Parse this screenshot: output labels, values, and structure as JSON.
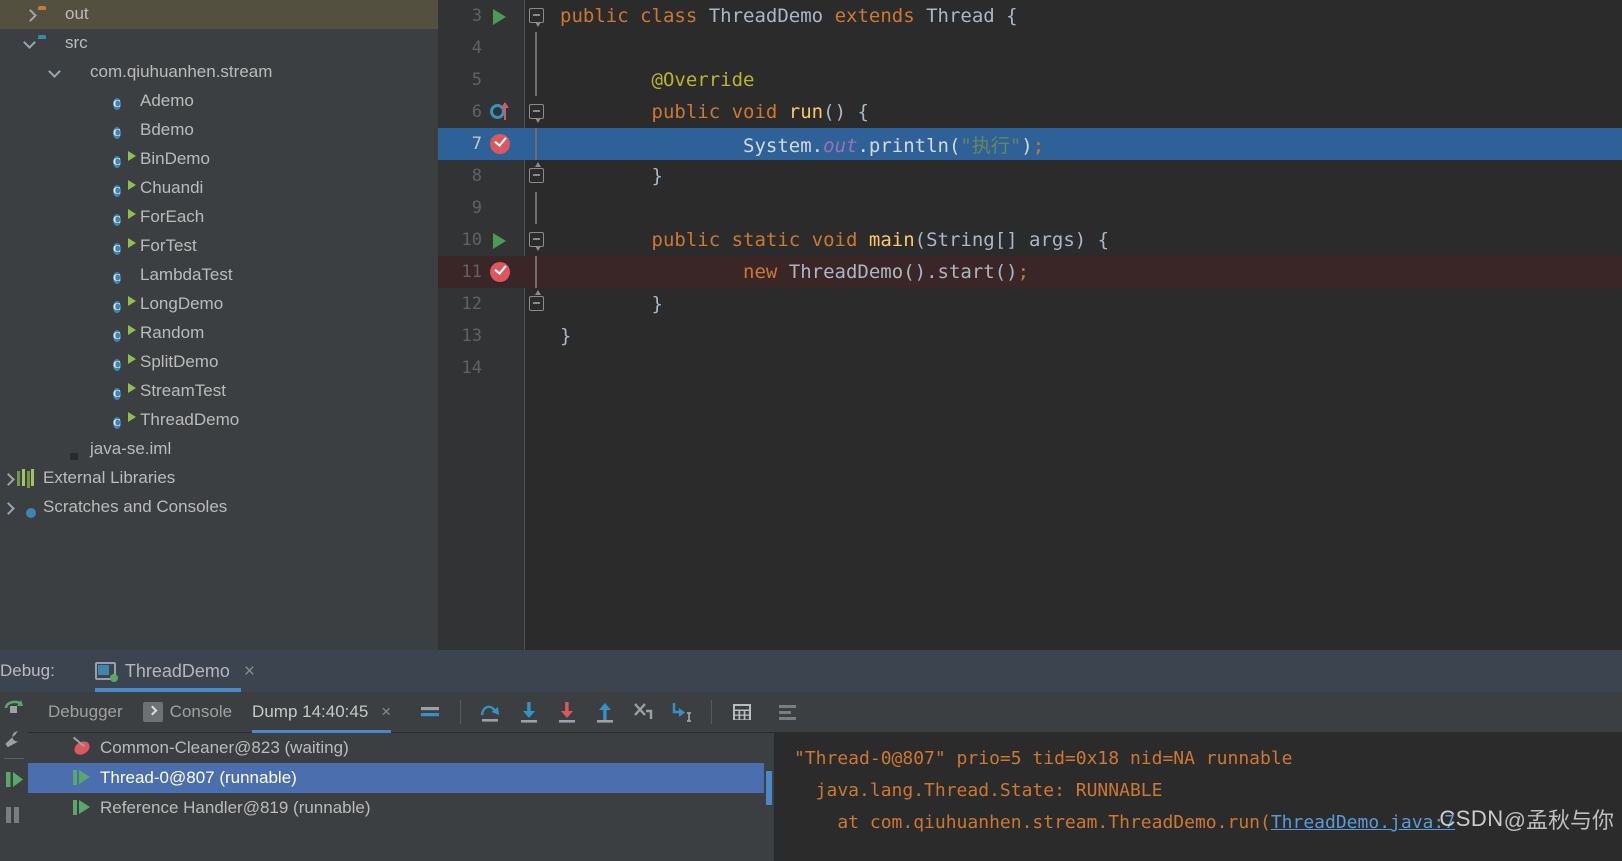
{
  "project_tree": {
    "items": [
      {
        "label": "out",
        "icon": "folder-orange-icon",
        "arrow": "right",
        "indent": 22,
        "selected": true
      },
      {
        "label": "src",
        "icon": "folder-blue-icon",
        "arrow": "down",
        "indent": 22,
        "selected": false
      },
      {
        "label": "com.qiuhuanhen.stream",
        "icon": "package-icon",
        "arrow": "down",
        "indent": 47,
        "selected": false
      },
      {
        "label": "Ademo",
        "icon": "class-icon",
        "arrow": "none",
        "indent": 97,
        "selected": false
      },
      {
        "label": "Bdemo",
        "icon": "class-icon",
        "arrow": "none",
        "indent": 97,
        "selected": false
      },
      {
        "label": "BinDemo",
        "icon": "class-runnable-icon",
        "arrow": "none",
        "indent": 97,
        "selected": false
      },
      {
        "label": "Chuandi",
        "icon": "class-runnable-icon",
        "arrow": "none",
        "indent": 97,
        "selected": false
      },
      {
        "label": "ForEach",
        "icon": "class-runnable-icon",
        "arrow": "none",
        "indent": 97,
        "selected": false
      },
      {
        "label": "ForTest",
        "icon": "class-runnable-icon",
        "arrow": "none",
        "indent": 97,
        "selected": false
      },
      {
        "label": "LambdaTest",
        "icon": "class-icon",
        "arrow": "none",
        "indent": 97,
        "selected": false
      },
      {
        "label": "LongDemo",
        "icon": "class-runnable-icon",
        "arrow": "none",
        "indent": 97,
        "selected": false
      },
      {
        "label": "Random",
        "icon": "class-runnable-icon",
        "arrow": "none",
        "indent": 97,
        "selected": false
      },
      {
        "label": "SplitDemo",
        "icon": "class-runnable-icon",
        "arrow": "none",
        "indent": 97,
        "selected": false
      },
      {
        "label": "StreamTest",
        "icon": "class-runnable-icon",
        "arrow": "none",
        "indent": 97,
        "selected": false
      },
      {
        "label": "ThreadDemo",
        "icon": "class-runnable-icon",
        "arrow": "none",
        "indent": 97,
        "selected": false
      },
      {
        "label": "java-se.iml",
        "icon": "iml-file-icon",
        "arrow": "none",
        "indent": 47,
        "selected": false
      },
      {
        "label": "External Libraries",
        "icon": "libraries-icon",
        "arrow": "right",
        "indent": 0,
        "selected": false
      },
      {
        "label": "Scratches and Consoles",
        "icon": "scratches-icon",
        "arrow": "right",
        "indent": 0,
        "selected": false
      }
    ]
  },
  "editor": {
    "lines": [
      {
        "num": "3",
        "gutter": "run-icon",
        "fold": "open",
        "highlight": "none",
        "indent": 0,
        "tokens": [
          {
            "t": "public ",
            "c": "kw"
          },
          {
            "t": "class ",
            "c": "kw"
          },
          {
            "t": "ThreadDemo ",
            "c": "cls"
          },
          {
            "t": "extends ",
            "c": "kw"
          },
          {
            "t": "Thread ",
            "c": "cls"
          },
          {
            "t": "{",
            "c": "pun"
          }
        ]
      },
      {
        "num": "4",
        "gutter": "none",
        "fold": "line",
        "highlight": "none",
        "indent": 0,
        "tokens": []
      },
      {
        "num": "5",
        "gutter": "none",
        "fold": "line",
        "highlight": "none",
        "indent": 4,
        "tokens": [
          {
            "t": "@Override",
            "c": "anno"
          }
        ]
      },
      {
        "num": "6",
        "gutter": "override-icon",
        "fold": "open",
        "highlight": "none",
        "indent": 4,
        "tokens": [
          {
            "t": "public ",
            "c": "kw"
          },
          {
            "t": "void ",
            "c": "kw"
          },
          {
            "t": "run",
            "c": "mth"
          },
          {
            "t": "() {",
            "c": "pun"
          }
        ]
      },
      {
        "num": "7",
        "gutter": "breakpoint-icon",
        "fold": "line",
        "highlight": "select",
        "indent": 8,
        "tokens": [
          {
            "t": "System",
            "c": "cls"
          },
          {
            "t": ".",
            "c": "pun"
          },
          {
            "t": "out",
            "c": "fld"
          },
          {
            "t": ".println(",
            "c": "pun"
          },
          {
            "t": "\"执行\"",
            "c": "str"
          },
          {
            "t": ")",
            "c": "pun"
          },
          {
            "t": ";",
            "c": "sem"
          }
        ]
      },
      {
        "num": "8",
        "gutter": "none",
        "fold": "close",
        "highlight": "none",
        "indent": 4,
        "tokens": [
          {
            "t": "}",
            "c": "pun"
          }
        ]
      },
      {
        "num": "9",
        "gutter": "none",
        "fold": "line",
        "highlight": "none",
        "indent": 0,
        "tokens": []
      },
      {
        "num": "10",
        "gutter": "run-icon",
        "fold": "open",
        "highlight": "none",
        "indent": 4,
        "tokens": [
          {
            "t": "public ",
            "c": "kw"
          },
          {
            "t": "static ",
            "c": "kw"
          },
          {
            "t": "void ",
            "c": "kw"
          },
          {
            "t": "main",
            "c": "mth"
          },
          {
            "t": "(",
            "c": "pun"
          },
          {
            "t": "String",
            "c": "cls"
          },
          {
            "t": "[] args) {",
            "c": "pun"
          }
        ]
      },
      {
        "num": "11",
        "gutter": "breakpoint-icon",
        "fold": "line",
        "highlight": "break",
        "indent": 8,
        "tokens": [
          {
            "t": "new ",
            "c": "kw"
          },
          {
            "t": "ThreadDemo",
            "c": "cls"
          },
          {
            "t": "().",
            "c": "pun"
          },
          {
            "t": "start",
            "c": "id"
          },
          {
            "t": "()",
            "c": "pun"
          },
          {
            "t": ";",
            "c": "sem"
          }
        ]
      },
      {
        "num": "12",
        "gutter": "none",
        "fold": "close",
        "highlight": "none",
        "indent": 4,
        "tokens": [
          {
            "t": "}",
            "c": "pun"
          }
        ]
      },
      {
        "num": "13",
        "gutter": "none",
        "fold": "none",
        "highlight": "none",
        "indent": 0,
        "tokens": [
          {
            "t": "}",
            "c": "pun"
          }
        ]
      },
      {
        "num": "14",
        "gutter": "none",
        "fold": "none",
        "highlight": "none",
        "indent": 0,
        "tokens": []
      }
    ]
  },
  "debug": {
    "title": "Debug:",
    "tab_label": "ThreadDemo",
    "tab_close": "×",
    "subtabs": [
      {
        "label": "Debugger",
        "icon": "none",
        "active": false,
        "closeable": false
      },
      {
        "label": "Console",
        "icon": "console-icon",
        "active": false,
        "closeable": false
      },
      {
        "label": "Dump 14:40:45",
        "icon": "none",
        "active": true,
        "closeable": true,
        "close": "×"
      }
    ],
    "toolbar_icons": [
      "mute-breakpoints-icon",
      "step-over-icon",
      "step-into-icon",
      "force-step-into-icon",
      "step-out-icon",
      "drop-frame-icon",
      "run-to-cursor-icon",
      "evaluate-expression-icon",
      "settings-icon"
    ],
    "rail_icons": [
      "resume-program-icon",
      "settings-wrench-icon",
      "pause-program-icon"
    ],
    "list_rail_icons": [
      "filter-icon",
      "copy-icon",
      "sort-icon"
    ],
    "threads": [
      {
        "label": "Common-Cleaner@823 (waiting)",
        "state": "waiting",
        "selected": false
      },
      {
        "label": "Thread-0@807 (runnable)",
        "state": "runnable",
        "selected": true
      },
      {
        "label": "Reference Handler@819 (runnable)",
        "state": "runnable",
        "selected": false
      }
    ],
    "detail": {
      "line1": "\"Thread-0@807\" prio=5 tid=0x18 nid=NA runnable",
      "line2": "  java.lang.Thread.State: RUNNABLE",
      "line3_pre": "    at com.qiuhuanhen.stream.ThreadDemo.run(",
      "line3_link": "ThreadDemo.java:7"
    }
  },
  "watermark": {
    "brand": "CSDN",
    "handle": "@孟秋与你"
  },
  "colors": {
    "accent_blue": "#4a88c7",
    "selection_blue": "#2f6199",
    "breakpoint_red": "#db5860",
    "run_green": "#499c54",
    "panel_bg": "#3c3f41",
    "editor_bg": "#2b2b2b"
  }
}
